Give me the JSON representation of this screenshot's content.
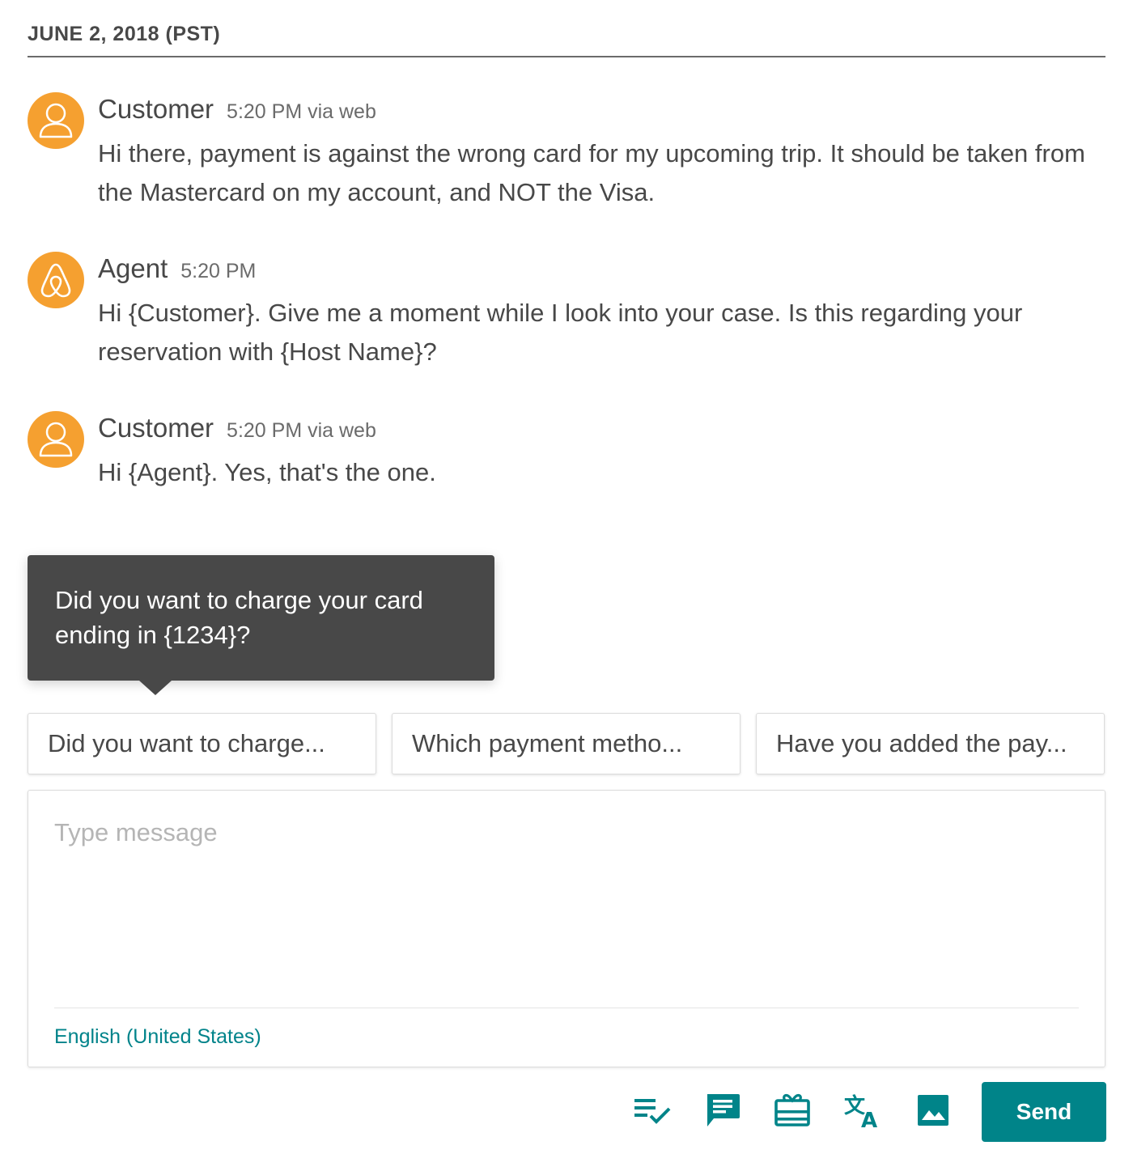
{
  "date_header": "JUNE 2, 2018 (PST)",
  "messages": [
    {
      "sender": "Customer",
      "time": "5:20 PM via web",
      "avatar_icon": "person-icon",
      "text": "Hi there, payment is against the wrong card for my upcoming trip. It should be taken from the Mastercard on my account, and NOT the Visa."
    },
    {
      "sender": "Agent",
      "time": "5:20 PM",
      "avatar_icon": "airbnb-logo-icon",
      "text": "Hi {Customer}. Give me a moment while I look into your case. Is this regarding your reservation with {Host Name}?"
    },
    {
      "sender": "Customer",
      "time": "5:20 PM via web",
      "avatar_icon": "person-icon",
      "text": "Hi {Agent}. Yes, that's the one."
    }
  ],
  "tooltip": {
    "text": "Did you want to charge your card ending in {1234}?"
  },
  "suggestions": [
    "Did you want to charge...",
    "Which payment metho...",
    "Have you added the pay..."
  ],
  "composer": {
    "placeholder": "Type message",
    "value": "",
    "language": "English (United States)"
  },
  "toolbar": {
    "icons": [
      "checklist-icon",
      "message-icon",
      "gift-card-icon",
      "translate-icon",
      "image-icon"
    ],
    "send_label": "Send"
  },
  "colors": {
    "avatar": "#f5a030",
    "accent": "#008489",
    "tooltip_bg": "#484848",
    "text": "#484848"
  }
}
